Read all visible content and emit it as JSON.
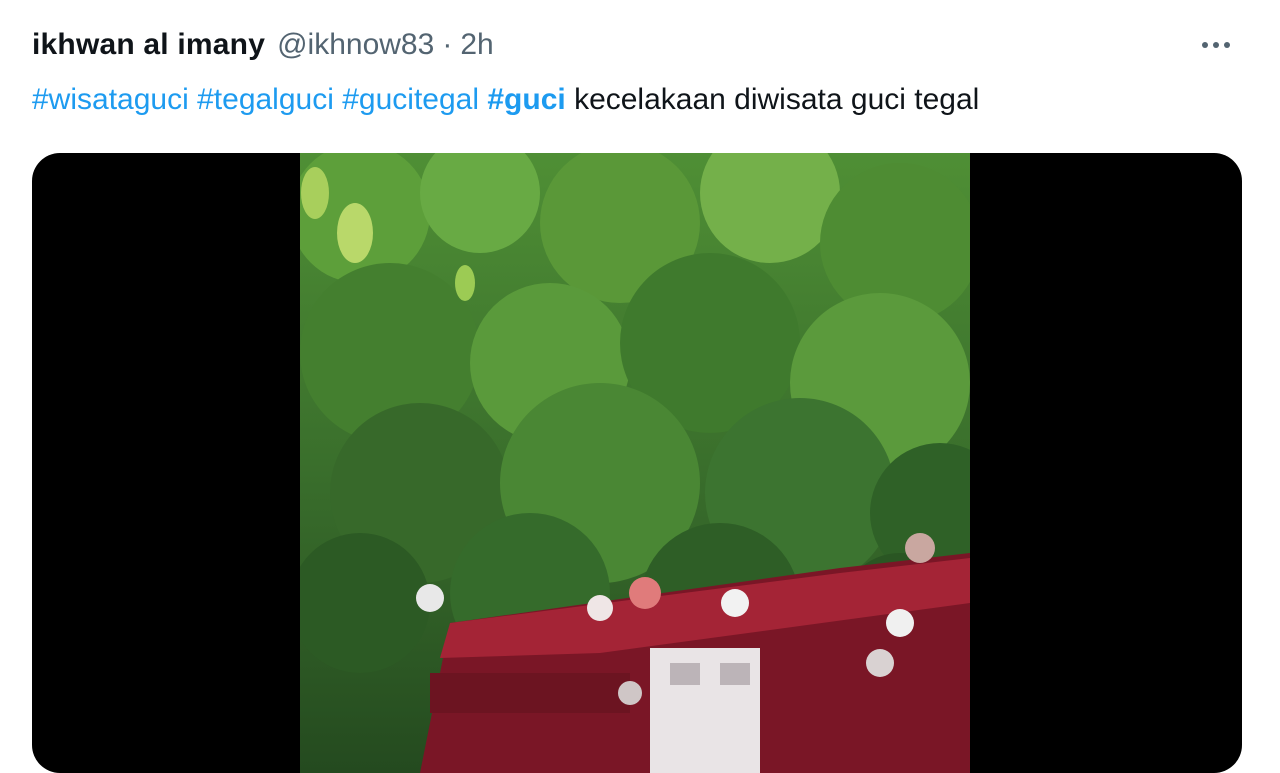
{
  "tweet": {
    "author_name": "ikhwan al imany",
    "handle": "@ikhnow83",
    "separator": "·",
    "time": "2h",
    "more_icon": "more-horizontal-icon",
    "hashtags": [
      "#wisataguci",
      "#tegalguci",
      "#gucitegal",
      "#guci"
    ],
    "text": "kecelakaan diwisata guci tegal"
  },
  "media": {
    "description_icon": "video-frame",
    "colors": {
      "background": "#000000",
      "foliage_dark": "#2f5a28",
      "foliage_light": "#6fae3e",
      "bus_red": "#8e1c2c"
    }
  }
}
